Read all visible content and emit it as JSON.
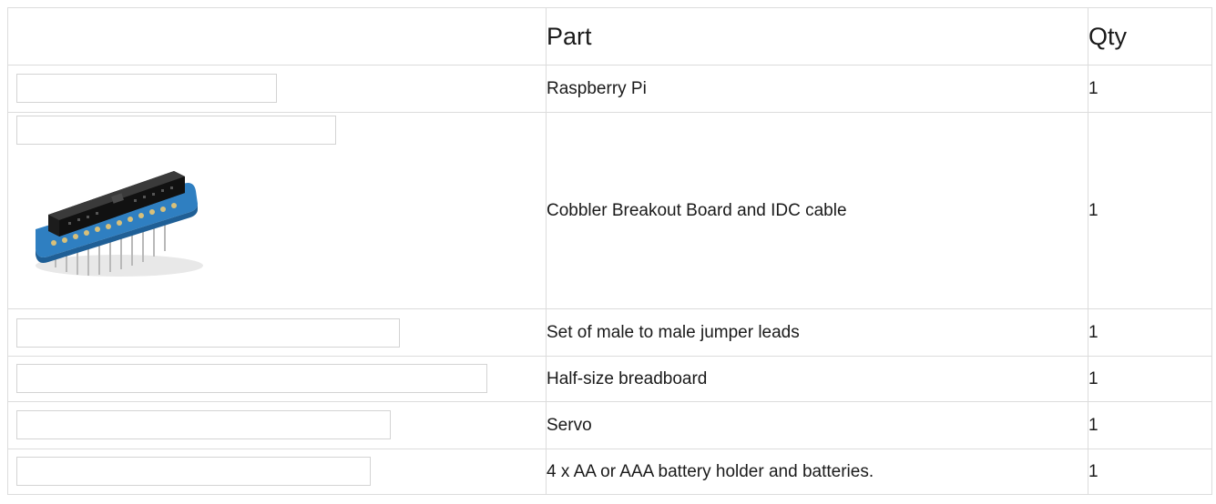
{
  "table": {
    "headers": {
      "image": "",
      "part": "Part",
      "qty": "Qty"
    },
    "rows": [
      {
        "part": "Raspberry Pi",
        "qty": "1"
      },
      {
        "part": "Cobbler Breakout Board and IDC cable",
        "qty": "1"
      },
      {
        "part": "Set of male to male jumper leads",
        "qty": "1"
      },
      {
        "part": "Half-size breadboard",
        "qty": "1"
      },
      {
        "part": "Servo",
        "qty": "1"
      },
      {
        "part": "4 x AA or AAA battery holder and batteries.",
        "qty": "1"
      }
    ]
  },
  "colors": {
    "border": "#dcdcdc",
    "text": "#1a1a1a",
    "board_blue": "#2f7fc1",
    "connector_black": "#1c1c1c"
  }
}
